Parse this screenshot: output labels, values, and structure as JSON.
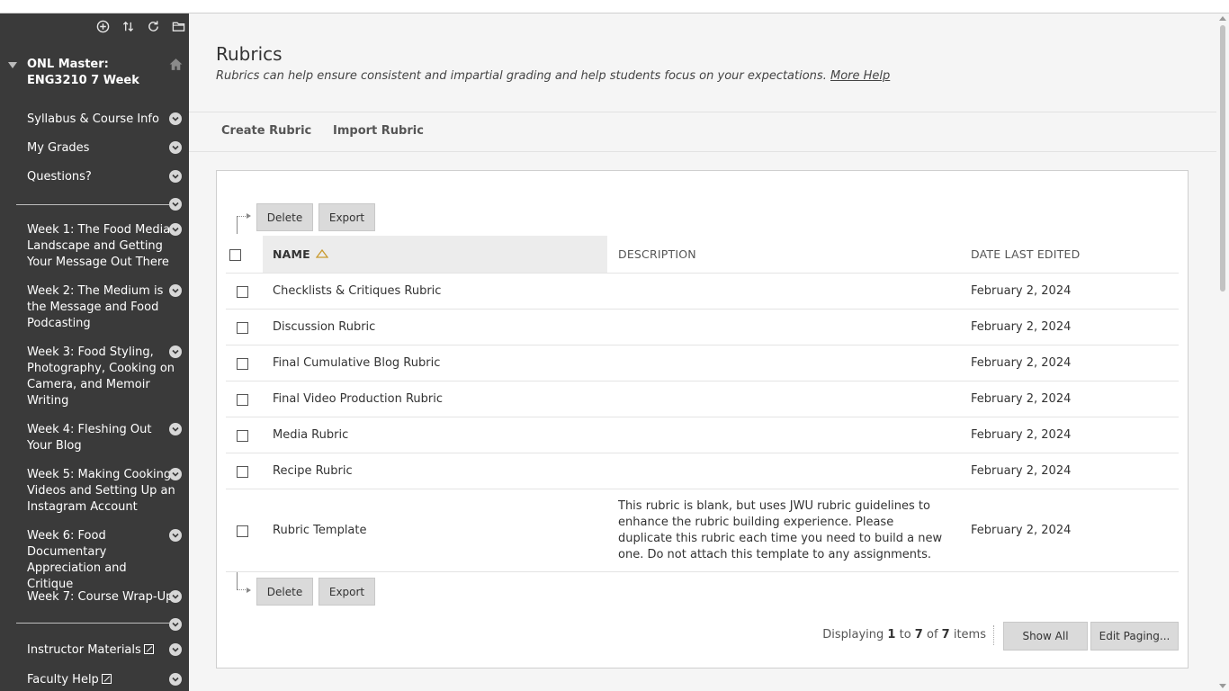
{
  "sidebar": {
    "course_title": "ONL Master: ENG3210 7 Week",
    "items_top": [
      {
        "label": "Syllabus & Course Info"
      },
      {
        "label": "My Grades"
      },
      {
        "label": "Questions?"
      }
    ],
    "weeks": [
      {
        "label": "Week 1: The Food Media Landscape and Getting Your Message Out There"
      },
      {
        "label": "Week 2: The Medium is the Message and Food Podcasting"
      },
      {
        "label": "Week 3: Food Styling, Photography, Cooking on Camera, and Memoir Writing"
      },
      {
        "label": "Week 4: Fleshing Out Your Blog"
      },
      {
        "label": "Week 5: Making Cooking Videos and Setting Up an Instagram Account"
      },
      {
        "label": "Week 6: Food Documentary Appreciation and Critique"
      },
      {
        "label": "Week 7: Course Wrap-Up"
      }
    ],
    "items_bottom": [
      {
        "label": "Instructor Materials"
      },
      {
        "label": "Faculty Help"
      }
    ]
  },
  "page": {
    "title": "Rubrics",
    "description": "Rubrics can help ensure consistent and impartial grading and help students focus on your expectations.",
    "more_help": "More Help"
  },
  "actions": {
    "create": "Create Rubric",
    "import": "Import Rubric"
  },
  "table": {
    "delete_label": "Delete",
    "export_label": "Export",
    "columns": {
      "name": "NAME",
      "description": "DESCRIPTION",
      "date": "DATE LAST EDITED"
    },
    "rows": [
      {
        "name": "Checklists & Critiques Rubric",
        "description": "",
        "date": "February 2, 2024"
      },
      {
        "name": "Discussion Rubric",
        "description": "",
        "date": "February 2, 2024"
      },
      {
        "name": "Final Cumulative Blog Rubric",
        "description": "",
        "date": "February 2, 2024"
      },
      {
        "name": "Final Video Production Rubric",
        "description": "",
        "date": "February 2, 2024"
      },
      {
        "name": "Media Rubric",
        "description": "",
        "date": "February 2, 2024"
      },
      {
        "name": "Recipe Rubric",
        "description": "",
        "date": "February 2, 2024"
      },
      {
        "name": "Rubric Template",
        "description": "This rubric is blank, but uses JWU rubric guidelines to enhance the rubric building experience. Please duplicate this rubric each time you need to build a new one. Do not attach this template to any assignments.",
        "date": "February 2, 2024"
      }
    ]
  },
  "paging": {
    "prefix": "Displaying",
    "from": "1",
    "to_word": "to",
    "to": "7",
    "of_word": "of",
    "total": "7",
    "suffix": "items",
    "show_all": "Show All",
    "edit_paging": "Edit Paging..."
  },
  "icons": {
    "toolbar": [
      "add-circle-icon",
      "sort-arrows-icon",
      "refresh-icon",
      "folder-icon"
    ],
    "home": "home-icon",
    "chevron": "chevron-down-icon",
    "external": "external-link-icon",
    "sort": "sort-ascending-icon"
  },
  "colors": {
    "sidebar_bg": "#3a3a3a",
    "page_bg": "#f5f5f5",
    "button_bg": "#dadada",
    "sort_indicator": "#c99a2e"
  }
}
